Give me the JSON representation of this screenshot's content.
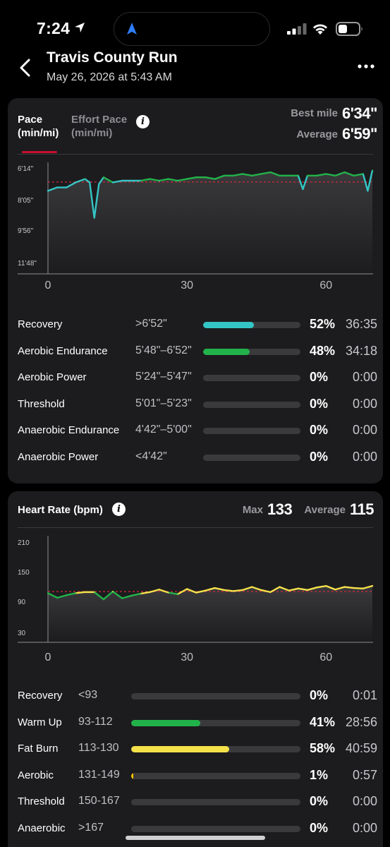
{
  "status_bar": {
    "time": "7:24"
  },
  "header": {
    "title": "Travis County Run",
    "subtitle": "May 26, 2026 at 5:43 AM"
  },
  "pace_card": {
    "tabs": [
      {
        "label": "Pace",
        "unit": "(min/mi)",
        "active": true
      },
      {
        "label": "Effort Pace",
        "unit": "(min/mi)",
        "active": false
      }
    ],
    "best_mile_label": "Best mile",
    "best_mile_value": "6'34\"",
    "average_label": "Average",
    "average_value": "6'59\"",
    "y_labels": [
      "6'14\"",
      "8'05\"",
      "9'56\"",
      "11'48\""
    ],
    "x_labels": [
      "0",
      "30",
      "60"
    ],
    "zones": [
      {
        "name": "Recovery",
        "range": ">6'52\"",
        "percent": "52%",
        "time": "36:35",
        "fill": 0.52,
        "color": "#34c6c6"
      },
      {
        "name": "Aerobic Endurance",
        "range": "5'48\"–6'52\"",
        "percent": "48%",
        "time": "34:18",
        "fill": 0.48,
        "color": "#22b24a"
      },
      {
        "name": "Aerobic Power",
        "range": "5'24\"–5'47\"",
        "percent": "0%",
        "time": "0:00",
        "fill": 0,
        "color": "#f0dc3c"
      },
      {
        "name": "Threshold",
        "range": "5'01\"–5'23\"",
        "percent": "0%",
        "time": "0:00",
        "fill": 0,
        "color": "#f08c28"
      },
      {
        "name": "Anaerobic Endurance",
        "range": "4'42\"–5'00\"",
        "percent": "0%",
        "time": "0:00",
        "fill": 0,
        "color": "#e03030"
      },
      {
        "name": "Anaerobic Power",
        "range": "<4'42\"",
        "percent": "0%",
        "time": "0:00",
        "fill": 0,
        "color": "#c01060"
      }
    ]
  },
  "hr_card": {
    "title": "Heart Rate (bpm)",
    "max_label": "Max",
    "max_value": "133",
    "average_label": "Average",
    "average_value": "115",
    "y_labels": [
      "210",
      "150",
      "90",
      "30"
    ],
    "x_labels": [
      "0",
      "30",
      "60"
    ],
    "zones": [
      {
        "name": "Recovery",
        "range": "<93",
        "percent": "0%",
        "time": "0:01",
        "fill": 0,
        "color": "#34c6c6"
      },
      {
        "name": "Warm Up",
        "range": "93-112",
        "percent": "41%",
        "time": "28:56",
        "fill": 0.41,
        "color": "#22b24a"
      },
      {
        "name": "Fat Burn",
        "range": "113-130",
        "percent": "58%",
        "time": "40:59",
        "fill": 0.58,
        "color": "#f5e14a"
      },
      {
        "name": "Aerobic",
        "range": "131-149",
        "percent": "1%",
        "time": "0:57",
        "fill": 0.01,
        "color": "#f5c400"
      },
      {
        "name": "Threshold",
        "range": "150-167",
        "percent": "0%",
        "time": "0:00",
        "fill": 0,
        "color": "#e03030"
      },
      {
        "name": "Anaerobic",
        "range": ">167",
        "percent": "0%",
        "time": "0:00",
        "fill": 0,
        "color": "#c01060"
      }
    ]
  },
  "colors": {
    "accent_red": "#c8102e",
    "pace_recovery": "#34c6c6",
    "pace_aerobic": "#22b24a",
    "hr_warmup": "#22b24a",
    "hr_fatburn": "#f5e14a",
    "average_line": "#d4283a"
  },
  "icons": [
    "location-arrow-icon",
    "navigation-icon",
    "signal-icon",
    "wifi-icon",
    "battery-icon",
    "back-chevron-icon",
    "more-icon",
    "info-icon"
  ],
  "chart_data": [
    {
      "type": "line",
      "title": "Pace (min/mi)",
      "x_ticks": [
        0,
        30,
        60
      ],
      "xlim": [
        0,
        70
      ],
      "y_ticks": [
        "6'14\"",
        "8'05\"",
        "9'56\"",
        "11'48\""
      ],
      "ylim_min_per_mi": [
        6.23,
        11.8
      ],
      "reference_line": {
        "label": "Average",
        "value": "6'59\"",
        "value_min_per_mi": 6.98
      },
      "series": [
        {
          "x": [
            0,
            2,
            4,
            6,
            8,
            9,
            10,
            11,
            12,
            14,
            16,
            18,
            20,
            22,
            24,
            26,
            28,
            30,
            32,
            34,
            36,
            38,
            40,
            42,
            44,
            46,
            48,
            50,
            52,
            54,
            55,
            56,
            58,
            60,
            62,
            64,
            66,
            68,
            69,
            70
          ],
          "y_min_per_mi": [
            7.5,
            7.3,
            7.3,
            7.0,
            6.8,
            7.0,
            9.1,
            7.1,
            6.7,
            7.0,
            6.9,
            6.9,
            6.9,
            6.8,
            6.9,
            6.8,
            6.9,
            6.8,
            6.7,
            6.7,
            6.8,
            6.6,
            6.6,
            6.5,
            6.6,
            6.5,
            6.4,
            6.6,
            6.6,
            6.6,
            7.4,
            6.6,
            6.6,
            6.5,
            6.6,
            6.4,
            6.6,
            6.5,
            7.5,
            6.3
          ]
        }
      ]
    },
    {
      "type": "line",
      "title": "Heart Rate (bpm)",
      "x_ticks": [
        0,
        30,
        60
      ],
      "xlim": [
        0,
        70
      ],
      "y_ticks": [
        210,
        150,
        90,
        30
      ],
      "ylim": [
        30,
        210
      ],
      "reference_line": {
        "label": "Average",
        "value": 115
      },
      "series": [
        {
          "x": [
            0,
            2,
            4,
            6,
            8,
            10,
            12,
            14,
            16,
            18,
            20,
            22,
            24,
            26,
            28,
            30,
            32,
            34,
            36,
            38,
            40,
            42,
            44,
            46,
            48,
            50,
            52,
            54,
            56,
            58,
            60,
            62,
            64,
            66,
            68,
            70
          ],
          "y": [
            112,
            103,
            108,
            112,
            114,
            114,
            100,
            115,
            102,
            107,
            111,
            114,
            119,
            113,
            110,
            120,
            113,
            117,
            122,
            118,
            116,
            118,
            124,
            118,
            114,
            124,
            117,
            121,
            118,
            123,
            126,
            119,
            124,
            122,
            121,
            126
          ]
        }
      ]
    }
  ]
}
